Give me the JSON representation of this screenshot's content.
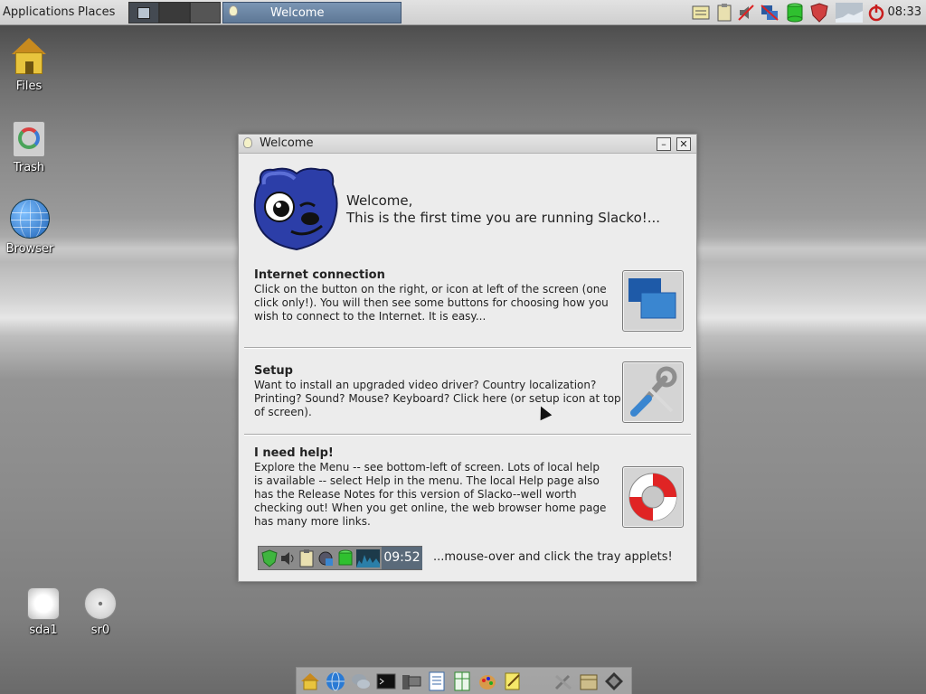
{
  "top_panel": {
    "menus": [
      "Applications",
      "Places"
    ],
    "active_task": "Welcome",
    "clock": "08:33",
    "tray_icons": [
      "notes-icon",
      "clipboard-icon",
      "volume-muted-icon",
      "network-disconnected-icon",
      "drive-icon",
      "firewall-icon",
      "cpu-graph-icon",
      "power-icon"
    ]
  },
  "desktop_icons": {
    "files": "Files",
    "trash": "Trash",
    "browser": "Browser",
    "sda1": "sda1",
    "sr0": "sr0"
  },
  "welcome_window": {
    "title": "Welcome",
    "minimize_symbol": "–",
    "close_symbol": "✕",
    "heading_line1": "Welcome,",
    "heading_line2": "This is the first time you are running Slacko!...",
    "sections": [
      {
        "title": "Internet connection",
        "body": "Click on the button on the right, or icon at left of the screen (one click only!). You will then see some buttons for choosing how you wish to connect to the Internet. It is easy...",
        "button_icon": "network-connect-icon"
      },
      {
        "title": "Setup",
        "body": "Want to install an upgraded video driver? Country localization? Printing? Sound? Mouse? Keyboard? Click here (or setup icon at top of screen).",
        "button_icon": "wrench-screwdriver-icon"
      },
      {
        "title": "I need help!",
        "body": "Explore the Menu -- see bottom-left of screen. Lots of local help is available -- select Help in the menu. The local Help page also has the Release Notes for this version of Slacko--well worth checking out! When you get online, the web browser home page has many more links.",
        "button_icon": "lifebuoy-icon"
      }
    ],
    "tray_preview_time": "09:52",
    "tray_hint": "...mouse-over and click the tray applets!"
  },
  "dock_icons": [
    "home-icon",
    "browser-globe-icon",
    "chat-icon",
    "terminal-icon",
    "computer-icon",
    "document-icon",
    "spreadsheet-icon",
    "paint-icon",
    "text-editor-icon",
    "tools-icon",
    "package-icon",
    "diamond-icon"
  ]
}
